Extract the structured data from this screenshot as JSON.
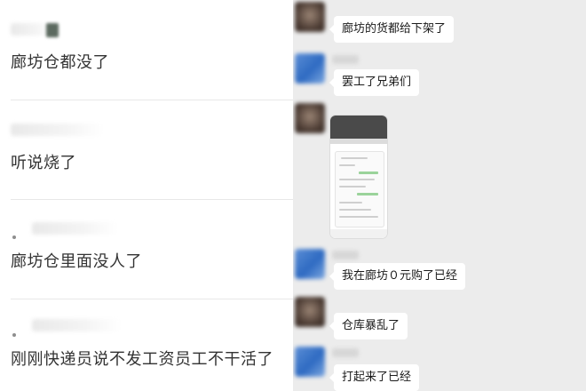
{
  "comments": [
    {
      "text": "廊坊仓都没了"
    },
    {
      "text": "听说烧了"
    },
    {
      "text": "廊坊仓里面没人了"
    },
    {
      "text": "刚刚快递员说不发工资员工不干活了"
    }
  ],
  "chat": {
    "messages": [
      {
        "text": "廊坊的货都给下架了",
        "avatar": "brown"
      },
      {
        "text": "罢工了兄弟们",
        "avatar": "blue"
      },
      {
        "text": "",
        "avatar": "brown",
        "image": "phone-screenshot"
      },
      {
        "text": "我在廊坊０元购了已经",
        "avatar": "blue"
      },
      {
        "text": "仓库暴乱了",
        "avatar": "brown"
      },
      {
        "text": "打起来了已经",
        "avatar": "blue"
      }
    ]
  },
  "colors": {
    "chat_background": "#ececec",
    "bubble": "#ffffff",
    "comment_text": "#333333"
  }
}
